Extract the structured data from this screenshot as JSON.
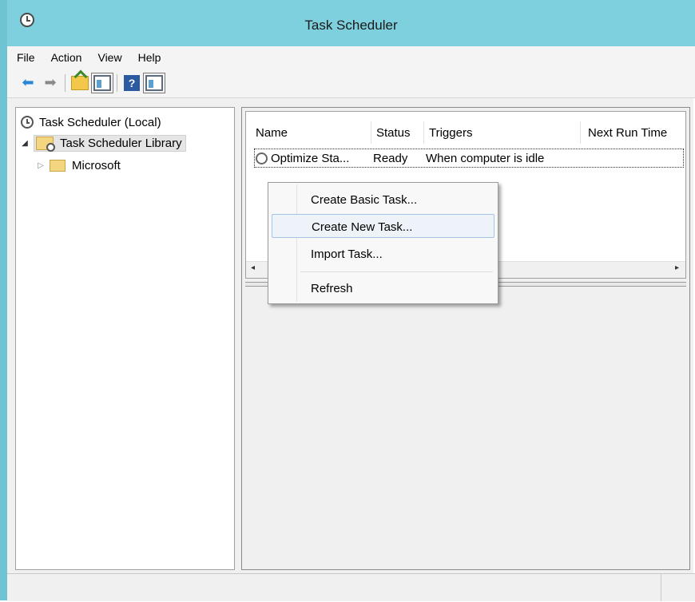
{
  "window": {
    "title": "Task Scheduler"
  },
  "menubar": {
    "items": [
      "File",
      "Action",
      "View",
      "Help"
    ]
  },
  "toolbar": {
    "buttons": [
      {
        "name": "back-arrow-icon"
      },
      {
        "name": "forward-arrow-icon"
      },
      {
        "name": "up-folder-icon"
      },
      {
        "name": "show-hide-console-tree-icon"
      },
      {
        "name": "help-icon",
        "glyph": "?"
      },
      {
        "name": "show-hide-action-pane-icon"
      }
    ]
  },
  "tree": {
    "root": "Task Scheduler (Local)",
    "library": "Task Scheduler Library",
    "microsoft": "Microsoft",
    "expanded_glyph": "◢",
    "collapsed_glyph": "▷"
  },
  "task_list": {
    "columns": [
      "Name",
      "Status",
      "Triggers",
      "Next Run Time"
    ],
    "rows": [
      {
        "name": "Optimize Sta...",
        "status": "Ready",
        "triggers": "When computer is idle",
        "next_run": ""
      }
    ],
    "scroll_left": "◂",
    "scroll_right": "▸"
  },
  "context_menu": {
    "items": [
      "Create Basic Task...",
      "Create New Task...",
      "Import Task...",
      "Refresh"
    ],
    "hovered": "Create New Task..."
  },
  "colors": {
    "titlebar": "#7fd0de",
    "window_border": "#6fc4d4",
    "hover_border": "#a6c4e6"
  }
}
